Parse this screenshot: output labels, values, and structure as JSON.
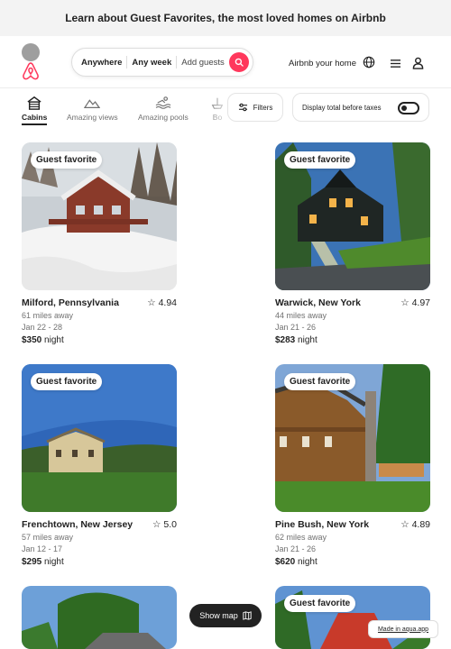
{
  "banner": {
    "text": "Learn about Guest Favorites, the most loved homes on Airbnb"
  },
  "header": {
    "search": {
      "anywhere": "Anywhere",
      "any_week": "Any week",
      "add_guests": "Add guests"
    },
    "host_link": "Airbnb your home",
    "icons": {
      "logo": "airbnb-logo",
      "search": "search-icon",
      "globe": "globe-icon",
      "menu": "menu-icon",
      "user": "user-icon"
    },
    "accent": "#ff385c"
  },
  "categories": [
    {
      "label": "Cabins",
      "icon": "cabin-icon",
      "active": true
    },
    {
      "label": "Amazing views",
      "icon": "mountain-icon",
      "active": false
    },
    {
      "label": "Amazing pools",
      "icon": "pool-icon",
      "active": false
    },
    {
      "label": "Bo",
      "icon": "boat-icon",
      "active": false
    }
  ],
  "filters": {
    "label": "Filters",
    "icon": "sliders-icon"
  },
  "taxes": {
    "label": "Display total before taxes",
    "enabled": false
  },
  "listings": [
    {
      "badge": "Guest favorite",
      "location": "Milford, Pennsylvania",
      "rating": "4.94",
      "distance": "61 miles away",
      "dates": "Jan 22 - 28",
      "price": "$350",
      "price_unit": "night"
    },
    {
      "badge": "Guest favorite",
      "location": "Warwick, New York",
      "rating": "4.97",
      "distance": "44 miles away",
      "dates": "Jan 21 - 26",
      "price": "$283",
      "price_unit": "night"
    },
    {
      "badge": "Guest favorite",
      "location": "Frenchtown, New Jersey",
      "rating": "5.0",
      "distance": "57 miles away",
      "dates": "Jan 12 - 17",
      "price": "$295",
      "price_unit": "night"
    },
    {
      "badge": "Guest favorite",
      "location": "Pine Bush, New York",
      "rating": "4.89",
      "distance": "62 miles away",
      "dates": "Jan 21 - 26",
      "price": "$620",
      "price_unit": "night"
    },
    {
      "badge": "",
      "location": "",
      "rating": "",
      "distance": "",
      "dates": "",
      "price": "",
      "price_unit": ""
    },
    {
      "badge": "Guest favorite",
      "location": "",
      "rating": "",
      "distance": "",
      "dates": "",
      "price": "",
      "price_unit": ""
    }
  ],
  "show_map": {
    "label": "Show map",
    "icon": "map-icon"
  },
  "made_in": "Made in aqua.app"
}
